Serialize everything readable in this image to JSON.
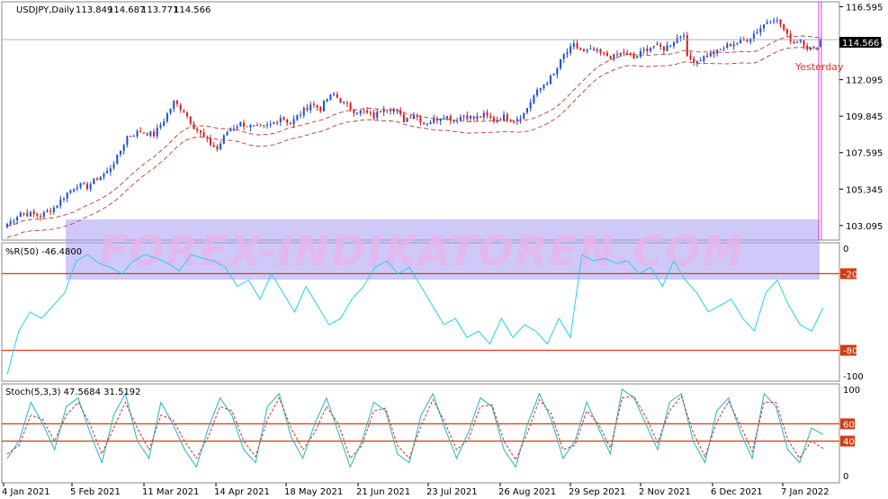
{
  "symbol_label": "USDJPY,Daily",
  "ohlc": [
    "113.849",
    "114.687",
    "113.771",
    "114.566"
  ],
  "current_price": "114.566",
  "yesterday_label": "Yesterday",
  "watermark": "FOREX-INDIKATOREN.COM",
  "colors": {
    "bull": "#1e4fd6",
    "bear": "#d61e1e",
    "envelope": "#c0392b",
    "wpr": "#22d3e6",
    "stoch_main": "#22b3c6",
    "stoch_signal": "#c0392b",
    "level": "#d63a10",
    "vline": "#d642d6",
    "watermark": "#8b7ff0"
  },
  "chart_data": [
    {
      "type": "candlestick",
      "title": "USDJPY,Daily",
      "yticks": [
        "116.595",
        "114.345",
        "112.095",
        "109.845",
        "107.595",
        "105.345",
        "103.095"
      ],
      "ylim": [
        102.2,
        116.9
      ],
      "xticks": [
        "4 Jan 2021",
        "5 Feb 2021",
        "11 Mar 2021",
        "14 Apr 2021",
        "18 May 2021",
        "21 Jun 2021",
        "23 Jul 2021",
        "26 Aug 2021",
        "29 Sep 2021",
        "2 Nov 2021",
        "6 Dec 2021",
        "7 Jan 2022"
      ],
      "close_trend": [
        [
          0,
          103.2
        ],
        [
          2,
          103.5
        ],
        [
          4,
          103.9
        ],
        [
          7,
          103.8
        ],
        [
          10,
          103.7
        ],
        [
          14,
          104.2
        ],
        [
          18,
          105.1
        ],
        [
          21,
          105.6
        ],
        [
          24,
          105.5
        ],
        [
          27,
          106.0
        ],
        [
          30,
          106.4
        ],
        [
          33,
          107.3
        ],
        [
          36,
          108.6
        ],
        [
          40,
          108.9
        ],
        [
          44,
          108.7
        ],
        [
          47,
          109.6
        ],
        [
          50,
          110.7
        ],
        [
          53,
          110.2
        ],
        [
          56,
          109.2
        ],
        [
          60,
          108.3
        ],
        [
          63,
          107.8
        ],
        [
          66,
          108.9
        ],
        [
          70,
          109.4
        ],
        [
          73,
          109.2
        ],
        [
          76,
          109.1
        ],
        [
          79,
          109.3
        ],
        [
          82,
          109.8
        ],
        [
          85,
          109.4
        ],
        [
          88,
          110.0
        ],
        [
          91,
          110.6
        ],
        [
          94,
          110.3
        ],
        [
          96,
          110.9
        ],
        [
          98,
          111.2
        ],
        [
          101,
          110.6
        ],
        [
          104,
          110.2
        ],
        [
          107,
          110.1
        ],
        [
          110,
          109.8
        ],
        [
          113,
          110.4
        ],
        [
          116,
          110.3
        ],
        [
          119,
          109.6
        ],
        [
          122,
          110.0
        ],
        [
          125,
          109.4
        ],
        [
          128,
          109.6
        ],
        [
          131,
          109.9
        ],
        [
          134,
          109.6
        ],
        [
          137,
          109.9
        ],
        [
          140,
          109.7
        ],
        [
          143,
          109.9
        ],
        [
          146,
          109.6
        ],
        [
          149,
          109.8
        ],
        [
          152,
          109.6
        ],
        [
          155,
          110.0
        ],
        [
          158,
          111.1
        ],
        [
          161,
          111.8
        ],
        [
          164,
          112.4
        ],
        [
          167,
          113.6
        ],
        [
          170,
          114.2
        ],
        [
          173,
          113.8
        ],
        [
          176,
          113.9
        ],
        [
          179,
          113.6
        ],
        [
          182,
          113.5
        ],
        [
          185,
          113.8
        ],
        [
          188,
          113.4
        ],
        [
          191,
          113.9
        ],
        [
          194,
          114.2
        ],
        [
          197,
          114.0
        ],
        [
          200,
          114.5
        ],
        [
          203,
          115.0
        ],
        [
          204,
          113.4
        ],
        [
          207,
          113.3
        ],
        [
          210,
          113.6
        ],
        [
          213,
          113.8
        ],
        [
          216,
          114.2
        ],
        [
          219,
          114.4
        ],
        [
          222,
          114.6
        ],
        [
          225,
          115.1
        ],
        [
          228,
          115.7
        ],
        [
          230,
          115.9
        ],
        [
          232,
          115.5
        ],
        [
          234,
          114.8
        ],
        [
          236,
          114.4
        ],
        [
          238,
          114.6
        ],
        [
          240,
          114.1
        ],
        [
          242,
          113.9
        ],
        [
          244,
          114.57
        ]
      ]
    },
    {
      "type": "line",
      "title": "%R(50) -46.4800",
      "yticks": [
        "0",
        "-20",
        "-80",
        "-100"
      ],
      "ylim": [
        -100,
        0
      ],
      "levels": [
        -20,
        -80
      ],
      "values": [
        -99,
        -65,
        -50,
        -55,
        -45,
        -35,
        -10,
        -5,
        -12,
        -15,
        -20,
        -10,
        -5,
        -8,
        -12,
        -18,
        -5,
        -8,
        -10,
        -15,
        -30,
        -25,
        -40,
        -20,
        -35,
        -50,
        -30,
        -45,
        -60,
        -55,
        -40,
        -30,
        -15,
        -10,
        -20,
        -15,
        -30,
        -45,
        -60,
        -55,
        -70,
        -65,
        -75,
        -55,
        -70,
        -60,
        -65,
        -75,
        -55,
        -70,
        -5,
        -10,
        -8,
        -12,
        -10,
        -20,
        -15,
        -30,
        -10,
        -25,
        -35,
        -50,
        -45,
        -40,
        -55,
        -65,
        -35,
        -25,
        -45,
        -60,
        -65,
        -46.48
      ]
    },
    {
      "type": "line",
      "title": "Stoch(5,3,3) 47.5684 31.5192",
      "yticks": [
        "100",
        "60",
        "40",
        "0"
      ],
      "ylim": [
        0,
        100
      ],
      "levels": [
        60,
        40
      ],
      "series": [
        {
          "values": [
            20,
            40,
            85,
            60,
            30,
            80,
            90,
            50,
            15,
            70,
            95,
            40,
            20,
            85,
            60,
            30,
            10,
            55,
            90,
            70,
            30,
            15,
            80,
            95,
            45,
            20,
            60,
            90,
            50,
            10,
            40,
            85,
            75,
            25,
            15,
            70,
            95,
            55,
            20,
            50,
            90,
            80,
            30,
            10,
            60,
            95,
            65,
            20,
            40,
            85,
            55,
            25,
            100,
            90,
            60,
            30,
            85,
            95,
            40,
            15,
            75,
            90,
            50,
            20,
            95,
            80,
            30,
            15,
            55,
            47.57
          ]
        },
        {
          "values": [
            25,
            35,
            70,
            65,
            40,
            70,
            85,
            60,
            25,
            55,
            85,
            55,
            30,
            70,
            65,
            40,
            20,
            45,
            80,
            75,
            40,
            22,
            65,
            90,
            55,
            30,
            50,
            80,
            60,
            20,
            35,
            75,
            78,
            35,
            20,
            58,
            88,
            62,
            30,
            42,
            80,
            82,
            40,
            18,
            50,
            88,
            72,
            30,
            35,
            75,
            60,
            32,
            90,
            92,
            68,
            38,
            75,
            92,
            50,
            22,
            62,
            86,
            58,
            28,
            85,
            85,
            42,
            20,
            40,
            31.52
          ]
        }
      ]
    }
  ]
}
